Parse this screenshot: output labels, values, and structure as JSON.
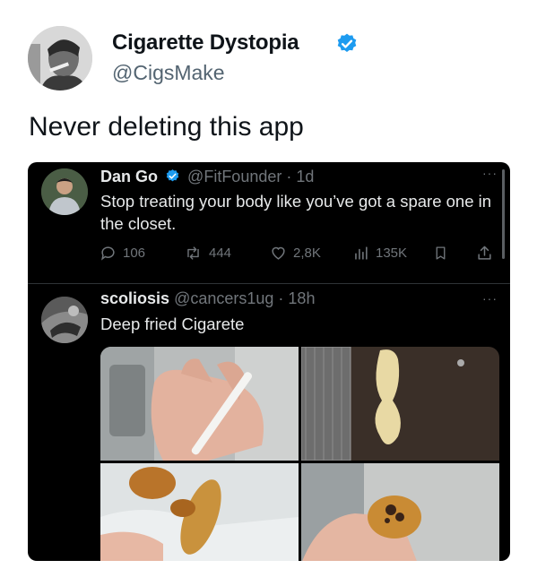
{
  "outer_post": {
    "display_name": "Cigarette Dystopia",
    "handle": "@CigsMake",
    "text": "Never deleting this app"
  },
  "embedded_posts": [
    {
      "display_name": "Dan Go",
      "handle": "@FitFounder",
      "time": "· 1d",
      "text": "Stop treating your body like you’ve got a spare one in the closet.",
      "more": "···",
      "metrics": {
        "replies": "106",
        "reposts": "444",
        "likes": "2,8K",
        "views": "135K"
      }
    },
    {
      "display_name": "scoliosis",
      "handle": "@cancers1ug",
      "time": "· 18h",
      "text": "Deep fried Cigarete",
      "more": "···"
    }
  ],
  "icons": [
    "verified-badge-icon",
    "reply-icon",
    "repost-icon",
    "like-icon",
    "views-icon",
    "bookmark-icon",
    "share-icon"
  ],
  "colors": {
    "verified_blue": "#1d9bf0",
    "dark_bg": "#000000",
    "text_gray": "#71767b",
    "handle_gray": "#536471"
  }
}
